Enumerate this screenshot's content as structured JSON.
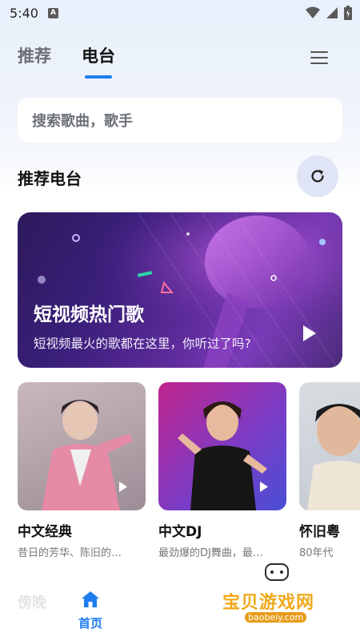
{
  "status_bar": {
    "time": "5:40",
    "app_badge": "A",
    "icons": [
      "wifi-icon",
      "signal-icon",
      "battery-icon"
    ]
  },
  "tabs": [
    {
      "label": "推荐",
      "active": false
    },
    {
      "label": "电台",
      "active": true
    }
  ],
  "search": {
    "placeholder": "搜索歌曲，歌手"
  },
  "section": {
    "title": "推荐电台",
    "refresh_icon": "refresh-icon"
  },
  "banner": {
    "title": "短视频热门歌",
    "subtitle": "短视频最火的歌都在这里，你听过了吗?"
  },
  "cards": [
    {
      "title": "中文经典",
      "desc": "昔日的芳华、陈旧的…"
    },
    {
      "title": "中文DJ",
      "desc": "最劲爆的DJ舞曲，最…"
    },
    {
      "title": "怀旧粤",
      "desc": "80年代"
    }
  ],
  "bottom": {
    "faded_label": "傍晚",
    "nav_home_label": "首页"
  },
  "watermark": {
    "text": "宝贝游戏网",
    "url": "baobeiy.com"
  },
  "colors": {
    "accent": "#1e7ef0",
    "refresh_bg": "#dfe4f6"
  }
}
